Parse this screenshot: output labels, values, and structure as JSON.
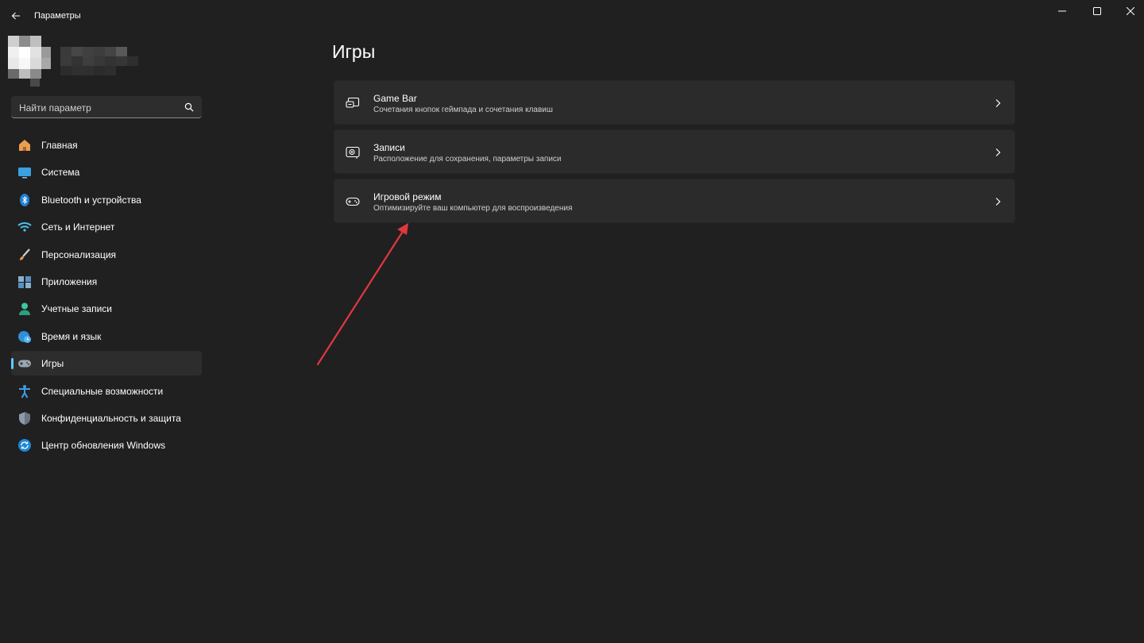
{
  "window": {
    "title": "Параметры"
  },
  "search": {
    "placeholder": "Найти параметр"
  },
  "sidebar": {
    "items": [
      {
        "label": "Главная",
        "icon": "home-icon"
      },
      {
        "label": "Система",
        "icon": "system-icon"
      },
      {
        "label": "Bluetooth и устройства",
        "icon": "bluetooth-icon"
      },
      {
        "label": "Сеть и Интернет",
        "icon": "wifi-icon"
      },
      {
        "label": "Персонализация",
        "icon": "brush-icon"
      },
      {
        "label": "Приложения",
        "icon": "apps-icon"
      },
      {
        "label": "Учетные записи",
        "icon": "account-icon"
      },
      {
        "label": "Время и язык",
        "icon": "globe-clock-icon"
      },
      {
        "label": "Игры",
        "icon": "gamepad-icon",
        "active": true
      },
      {
        "label": "Специальные возможности",
        "icon": "accessibility-icon"
      },
      {
        "label": "Конфиденциальность и защита",
        "icon": "shield-icon"
      },
      {
        "label": "Центр обновления Windows",
        "icon": "update-icon"
      }
    ]
  },
  "main": {
    "title": "Игры",
    "cards": [
      {
        "title": "Game Bar",
        "subtitle": "Сочетания кнопок геймпада и сочетания клавиш",
        "icon": "game-bar-icon"
      },
      {
        "title": "Записи",
        "subtitle": "Расположение для сохранения, параметры записи",
        "icon": "capture-icon"
      },
      {
        "title": "Игровой режим",
        "subtitle": "Оптимизируйте ваш компьютер для воспроизведения",
        "icon": "game-mode-icon"
      }
    ]
  },
  "colors": {
    "background": "#202020",
    "card": "#2b2b2b",
    "accent": "#60cdff",
    "annotation": "#e0383e"
  }
}
